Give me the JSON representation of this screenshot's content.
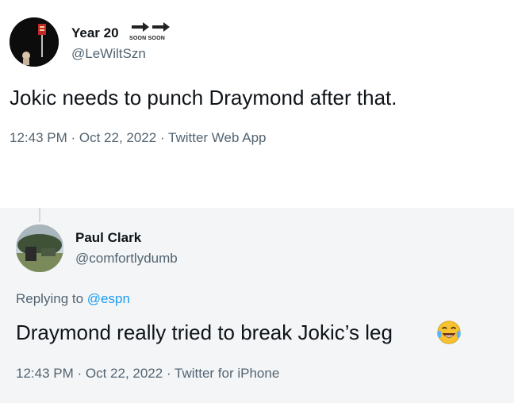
{
  "tweet1": {
    "name": "Year 20",
    "badge_text": "SOON SOON",
    "handle": "@LeWiltSzn",
    "text": "Jokic needs to punch Draymond after that.",
    "meta": "12:43 PM · Oct 22, 2022 · Twitter Web App"
  },
  "tweet2": {
    "name": "Paul Clark",
    "handle": "@comfortlydumb",
    "reply_prefix": "Replying to ",
    "reply_mention": "@espn",
    "text": "Draymond really tried to break Jokic’s leg",
    "emoji": "face-with-tears-of-joy",
    "meta": "12:43 PM · Oct 22, 2022 · Twitter for iPhone"
  },
  "colors": {
    "text": "#0f1419",
    "secondary": "#536471",
    "link": "#1d9bf0",
    "card2_bg": "#f3f5f7"
  }
}
